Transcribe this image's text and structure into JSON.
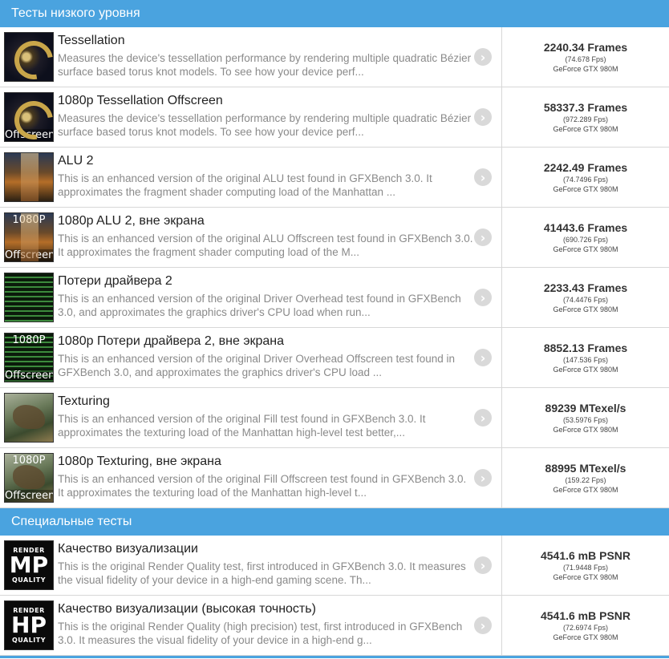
{
  "sections": [
    {
      "header": "Тесты низкого уровня",
      "rows": [
        {
          "thumb": "t-tess",
          "thumb_top": "",
          "thumb_bottom": "",
          "title": "Tessellation",
          "desc": "Measures the device's tessellation performance by rendering multiple quadratic Bézier surface based torus knot models. To see how your device perf...",
          "score": "2240.34 Frames",
          "fps": "(74.678 Fps)",
          "gpu": "GeForce GTX 980M"
        },
        {
          "thumb": "t-tess",
          "thumb_top": "",
          "thumb_bottom": "Offscreen",
          "title": "1080p Tessellation Offscreen",
          "desc": "Measures the device's tessellation performance by rendering multiple quadratic Bézier surface based torus knot models. To see how your device perf...",
          "score": "58337.3 Frames",
          "fps": "(972.289 Fps)",
          "gpu": "GeForce GTX 980M"
        },
        {
          "thumb": "t-alu",
          "thumb_top": "",
          "thumb_bottom": "",
          "title": "ALU 2",
          "desc": "This is an enhanced version of the original ALU test found in GFXBench 3.0. It approximates the fragment shader computing load of the Manhattan ...",
          "score": "2242.49 Frames",
          "fps": "(74.7496 Fps)",
          "gpu": "GeForce GTX 980M"
        },
        {
          "thumb": "t-alu",
          "thumb_top": "1080P",
          "thumb_bottom": "Offscreen",
          "title": "1080p ALU 2, вне экрана",
          "desc": "This is an enhanced version of the original ALU Offscreen test found in GFXBench 3.0. It approximates the fragment shader computing load of the M...",
          "score": "41443.6 Frames",
          "fps": "(690.726 Fps)",
          "gpu": "GeForce GTX 980M"
        },
        {
          "thumb": "t-drv",
          "thumb_top": "",
          "thumb_bottom": "",
          "title": "Потери драйвера 2",
          "desc": "This is an enhanced version of the original Driver Overhead test found in GFXBench 3.0, and approximates the graphics driver's CPU load when run...",
          "score": "2233.43 Frames",
          "fps": "(74.4476 Fps)",
          "gpu": "GeForce GTX 980M"
        },
        {
          "thumb": "t-drv",
          "thumb_top": "1080P",
          "thumb_bottom": "Offscreen",
          "title": "1080p Потери драйвера 2, вне экрана",
          "desc": "This is an enhanced version of the original Driver Overhead Offscreen test found in GFXBench 3.0, and approximates the graphics driver's CPU load ...",
          "score": "8852.13 Frames",
          "fps": "(147.536 Fps)",
          "gpu": "GeForce GTX 980M"
        },
        {
          "thumb": "t-tex",
          "thumb_top": "",
          "thumb_bottom": "",
          "title": "Texturing",
          "desc": "This is an enhanced version of the original Fill test found in GFXBench 3.0. It approximates the texturing load of the Manhattan high-level test better,...",
          "score": "89239 MTexel/s",
          "fps": "(53.5976 Fps)",
          "gpu": "GeForce GTX 980M"
        },
        {
          "thumb": "t-tex",
          "thumb_top": "1080P",
          "thumb_bottom": "Offscreen",
          "title": "1080p Texturing, вне экрана",
          "desc": "This is an enhanced version of the original Fill Offscreen test found in GFXBench 3.0. It approximates the texturing load of the Manhattan high-level t...",
          "score": "88995 MTexel/s",
          "fps": "(159.22 Fps)",
          "gpu": "GeForce GTX 980M"
        }
      ]
    },
    {
      "header": "Специальные тесты",
      "rows": [
        {
          "thumb": "t-mp",
          "rq_top": "RENDER",
          "rq_mid": "MP",
          "rq_bottom": "QUALITY",
          "title": "Качество визуализации",
          "desc": "This is the original Render Quality test, first introduced in GFXBench 3.0. It measures the visual fidelity of your device in a high-end gaming scene. Th...",
          "score": "4541.6 mB PSNR",
          "fps": "(71.9448 Fps)",
          "gpu": "GeForce GTX 980M"
        },
        {
          "thumb": "t-hp",
          "rq_top": "RENDER",
          "rq_mid": "HP",
          "rq_bottom": "QUALITY",
          "title": "Качество визуализации (высокая точность)",
          "desc": "This is the original Render Quality (high precision) test, first introduced in GFXBench 3.0. It measures the visual fidelity of your device in a high-end g...",
          "score": "4541.6 mB PSNR",
          "fps": "(72.6974 Fps)",
          "gpu": "GeForce GTX 980M"
        }
      ]
    }
  ],
  "go_icon": "chevron-right-icon",
  "colors": {
    "header_bg": "#4aa3df",
    "border": "#d7d7d7",
    "desc": "#8a8a8a",
    "button": "#d9d9d9"
  }
}
